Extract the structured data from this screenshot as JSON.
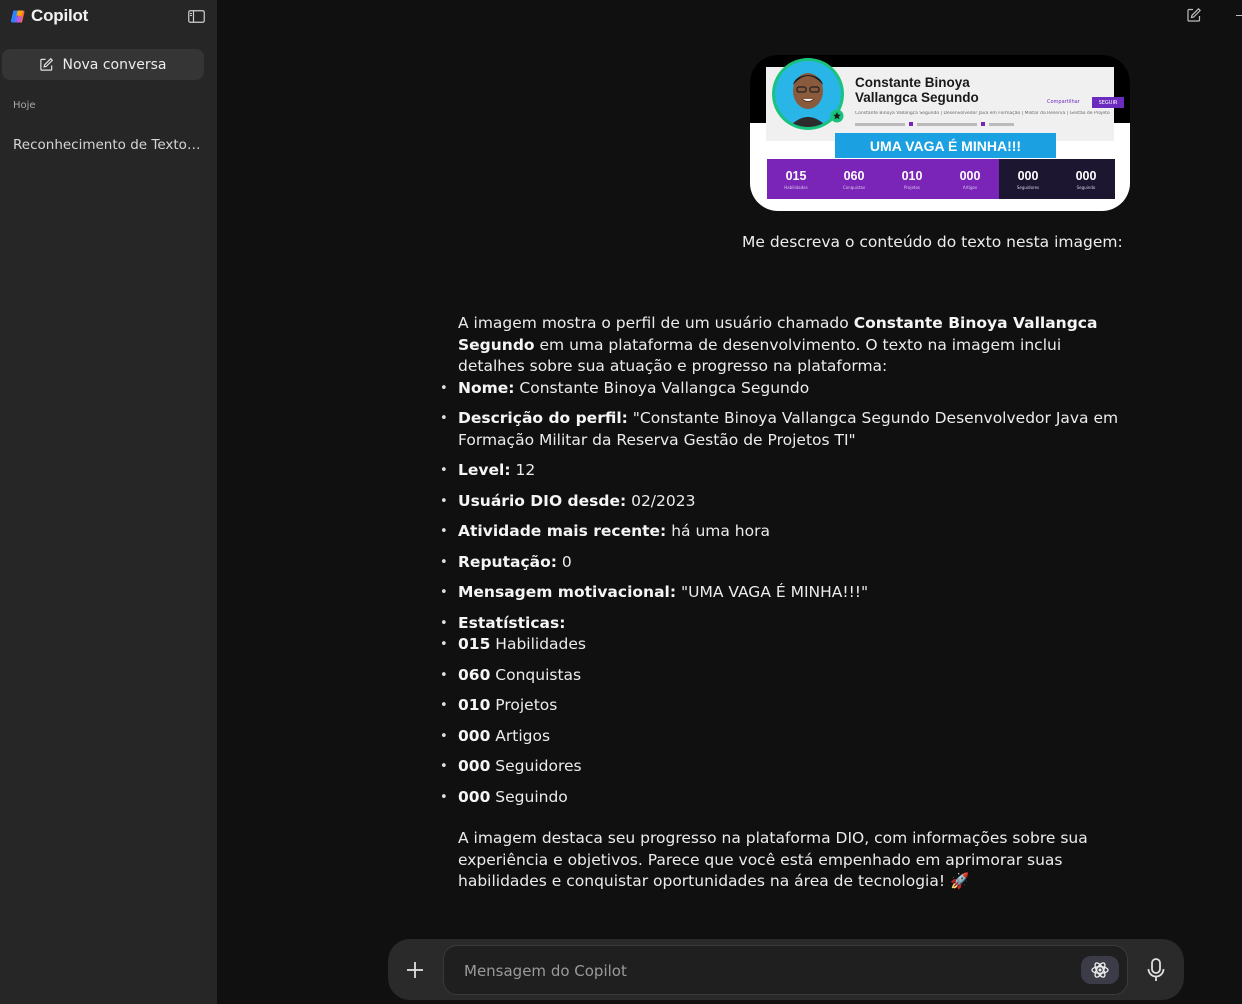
{
  "sidebar": {
    "brand": "Copilot",
    "new_chat_label": "Nova conversa",
    "section_label": "Hoje",
    "history": [
      "Reconhecimento de Texto em Imagem"
    ]
  },
  "attachment": {
    "profile_name": "Constante Binoya Vallangca Segundo",
    "tiny_link": "Compartilhar",
    "follow_label": "SEGUIR",
    "description": "Constante Binoya Vallangca Segundo | Desenvolvedor Java em Formação | Militar da Reserva | Gestão de Projetos TI",
    "banner": "UMA VAGA É MINHA!!!",
    "stats": [
      {
        "num": "015",
        "label": "Habilidades"
      },
      {
        "num": "060",
        "label": "Conquistas"
      },
      {
        "num": "010",
        "label": "Projetos"
      },
      {
        "num": "000",
        "label": "Artigos"
      },
      {
        "num": "000",
        "label": "Seguidores"
      },
      {
        "num": "000",
        "label": "Seguindo"
      }
    ]
  },
  "user_message": "Me descreva o conteúdo do texto nesta imagem:",
  "reply": {
    "intro_a": "A imagem mostra o perfil de um usuário chamado ",
    "intro_name": "Constante Binoya Vallangca Segundo",
    "intro_b": " em uma plataforma de desenvolvimento. O texto na imagem inclui detalhes sobre sua atuação e progresso na plataforma:",
    "items": [
      {
        "label": "Nome:",
        "value": " Constante Binoya Vallangca Segundo"
      },
      {
        "label": "Descrição do perfil:",
        "value": " \"Constante Binoya Vallangca Segundo  Desenvolvedor Java em Formação  Militar da Reserva  Gestão de Projetos TI\""
      },
      {
        "label": "Level:",
        "value": " 12"
      },
      {
        "label": "Usuário DIO desde:",
        "value": " 02/2023"
      },
      {
        "label": "Atividade mais recente:",
        "value": " há uma hora"
      },
      {
        "label": "Reputação:",
        "value": " 0"
      },
      {
        "label": "Mensagem motivacional:",
        "value": " \"UMA VAGA É MINHA!!!\""
      },
      {
        "label": "Estatísticas:",
        "value": ""
      }
    ],
    "stats": [
      {
        "num": "015",
        "label": " Habilidades"
      },
      {
        "num": "060",
        "label": " Conquistas"
      },
      {
        "num": "010",
        "label": " Projetos"
      },
      {
        "num": "000",
        "label": " Artigos"
      },
      {
        "num": "000",
        "label": " Seguidores"
      },
      {
        "num": "000",
        "label": " Seguindo"
      }
    ],
    "closing": "A imagem destaca seu progresso na plataforma DIO, com informações sobre sua experiência e objetivos. Parece que você está empenhado em aprimorar suas habilidades e conquistar oportunidades na área de tecnologia! 🚀"
  },
  "composer": {
    "placeholder": "Mensagem do Copilot"
  },
  "colors": {
    "background": "#101010",
    "sidebar": "#262626",
    "stats_purple": "#7b25b8",
    "banner_blue": "#1ba1e2"
  }
}
